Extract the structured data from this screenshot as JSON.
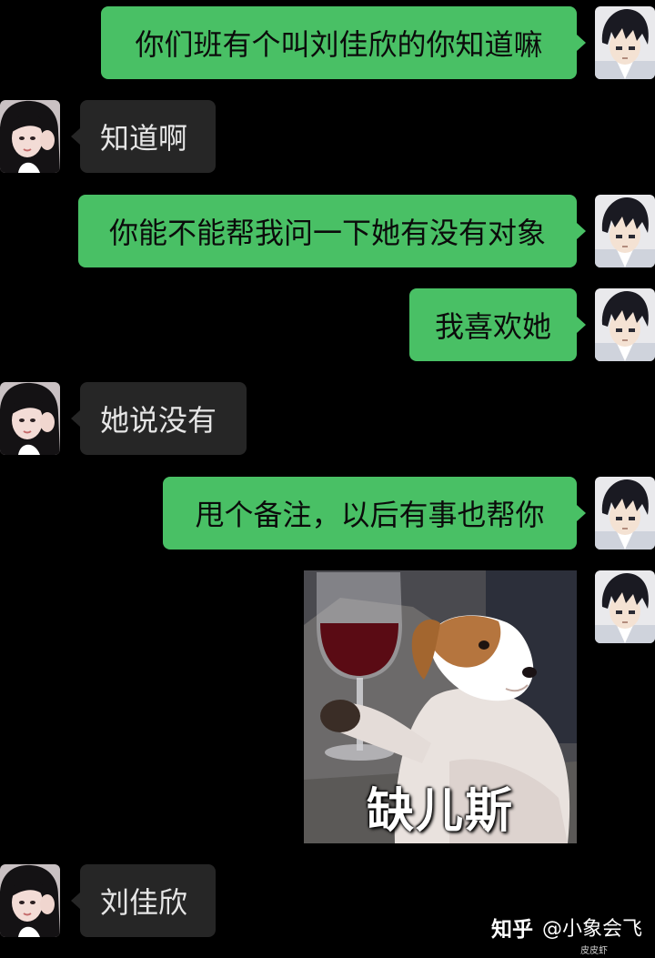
{
  "messages": [
    {
      "side": "right",
      "text": "你们班有个叫刘佳欣的你知道嘛"
    },
    {
      "side": "left",
      "text": "知道啊"
    },
    {
      "side": "right",
      "text": "你能不能帮我问一下她有没有对象"
    },
    {
      "side": "right",
      "text": "我喜欢她"
    },
    {
      "side": "left",
      "text": "她说没有"
    },
    {
      "side": "right",
      "text": "甩个备注，以后有事也帮你"
    },
    {
      "side": "right",
      "type": "sticker",
      "caption": "缺儿斯"
    },
    {
      "side": "left",
      "text": "刘佳欣"
    }
  ],
  "watermark": {
    "logo": "知乎",
    "author": "@小象会飞",
    "sub": "皮皮虾"
  },
  "colors": {
    "background": "#000000",
    "sent_bubble": "#49c065",
    "received_bubble": "#262626"
  },
  "icons": {
    "sent_avatar": "anime-boy-avatar-icon",
    "received_avatar": "girl-photo-avatar-icon",
    "sticker": "dog-with-wine-glass-sticker"
  }
}
